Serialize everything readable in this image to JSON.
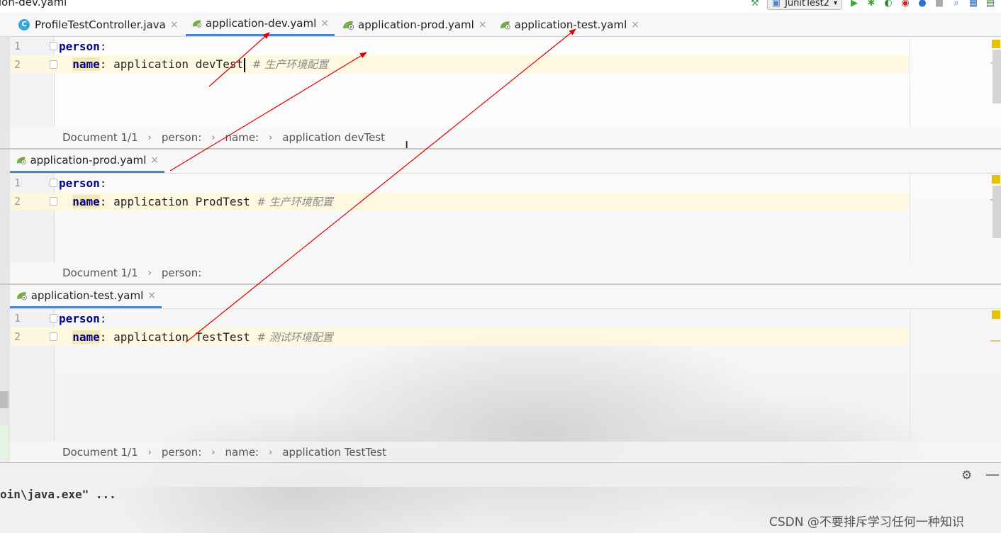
{
  "window": {
    "title_fragment": "ion-dev.yaml",
    "run_config": "JunitTest2"
  },
  "toolbar": {
    "icons": [
      "hammer-icon",
      "run-config-icon",
      "run-icon",
      "debug-icon",
      "coverage-icon",
      "profile-icon",
      "stop-icon",
      "search-icon",
      "project-structure-icon",
      "terminal-icon"
    ]
  },
  "tabs": [
    {
      "label": "ProfileTestController.java",
      "icon": "java-class-icon",
      "icon_letter": "C",
      "active": false
    },
    {
      "label": "application-dev.yaml",
      "icon": "spring-yaml-icon",
      "active": true
    },
    {
      "label": "application-prod.yaml",
      "icon": "spring-yaml-icon",
      "active": false
    },
    {
      "label": "application-test.yaml",
      "icon": "spring-yaml-icon",
      "active": false
    }
  ],
  "close_glyph": "×",
  "editors": [
    {
      "file": "application-dev.yaml",
      "lines": [
        {
          "num": "1",
          "key": "person",
          "colon": ":",
          "value": "",
          "comment": ""
        },
        {
          "num": "2",
          "key": "name",
          "colon": ":",
          "value": " application devTest",
          "comment": "# 生产环境配置"
        }
      ],
      "breadcrumb": [
        "Document 1/1",
        "person:",
        "name:",
        "application devTest"
      ]
    },
    {
      "file": "application-prod.yaml",
      "lines": [
        {
          "num": "1",
          "key": "person",
          "colon": ":",
          "value": "",
          "comment": ""
        },
        {
          "num": "2",
          "key": "name",
          "colon": ":",
          "value": " application ProdTest",
          "comment": "# 生产环境配置"
        }
      ],
      "breadcrumb": [
        "Document 1/1",
        "person:"
      ]
    },
    {
      "file": "application-test.yaml",
      "lines": [
        {
          "num": "1",
          "key": "person",
          "colon": ":",
          "value": "",
          "comment": ""
        },
        {
          "num": "2",
          "key": "name",
          "colon": ":",
          "value": " application TestTest",
          "comment": "# 测试环境配置"
        }
      ],
      "breadcrumb": [
        "Document 1/1",
        "person:",
        "name:",
        "application TestTest"
      ]
    }
  ],
  "console": {
    "text": "oin\\java.exe\" ..."
  },
  "watermark": "CSDN @不要排斥学习任何一种知识",
  "colors": {
    "annotation_arrow": "#e00000",
    "yaml_key": "#000080",
    "active_tab_underline": "#4a86c8",
    "stripe_marker": "#e8c200"
  }
}
